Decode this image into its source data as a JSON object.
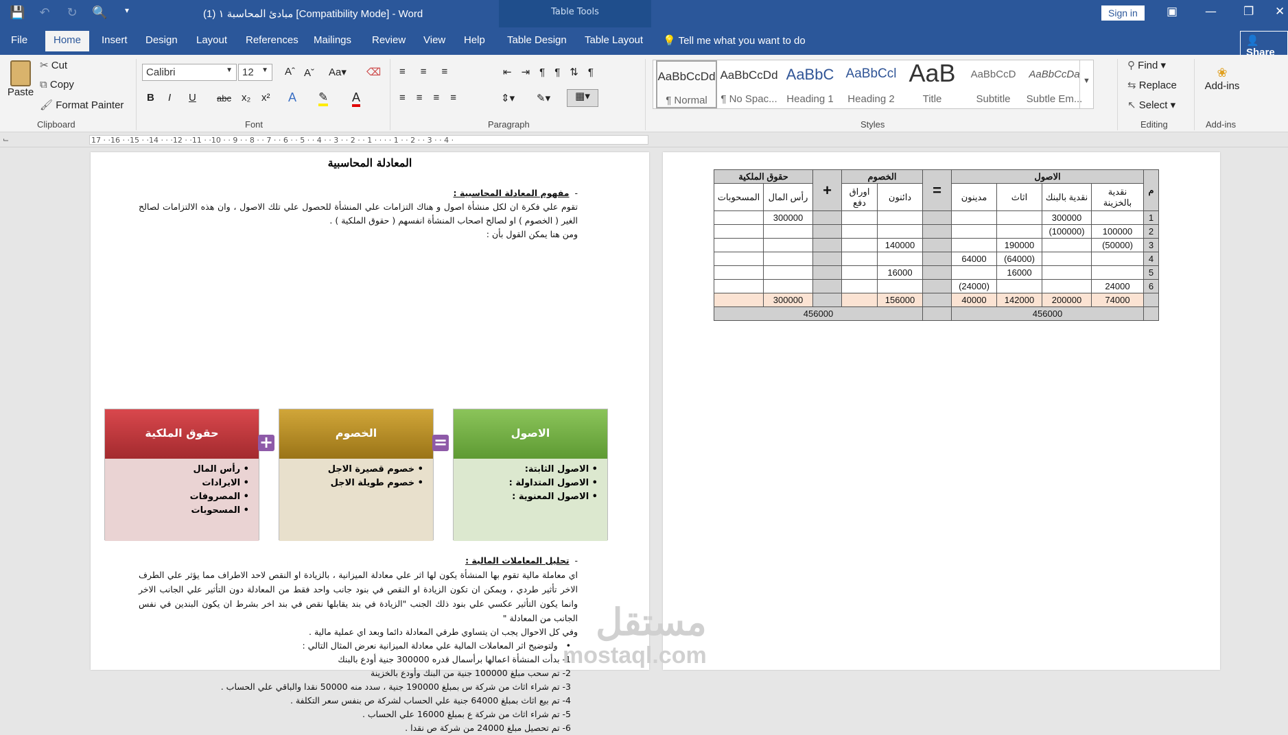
{
  "window": {
    "title": "مبادئ المحاسبة ١ (1) [Compatibility Mode]  -  Word",
    "context_tab_group": "Table Tools",
    "sign_in": "Sign in",
    "share": "Share"
  },
  "tabs": [
    "File",
    "Home",
    "Insert",
    "Design",
    "Layout",
    "References",
    "Mailings",
    "Review",
    "View",
    "Help",
    "Table Design",
    "Table Layout"
  ],
  "tell_me": "Tell me what you want to do",
  "ribbon": {
    "clipboard": {
      "paste": "Paste",
      "cut": "Cut",
      "copy": "Copy",
      "format_painter": "Format Painter",
      "label": "Clipboard"
    },
    "font": {
      "name": "Calibri",
      "size": "12",
      "label": "Font",
      "case": "Aa",
      "bold": "B",
      "italic": "I",
      "underline": "U",
      "strike": "abc",
      "sub": "x₂",
      "sup": "x²"
    },
    "paragraph": {
      "label": "Paragraph"
    },
    "styles": {
      "label": "Styles",
      "items": [
        {
          "preview": "AaBbCcDd",
          "name": "¶ Normal"
        },
        {
          "preview": "AaBbCcDd",
          "name": "¶ No Spac..."
        },
        {
          "preview": "AaBbC",
          "name": "Heading 1"
        },
        {
          "preview": "AaBbCcl",
          "name": "Heading 2"
        },
        {
          "preview": "AaB",
          "name": "Title"
        },
        {
          "preview": "AaBbCcD",
          "name": "Subtitle"
        },
        {
          "preview": "AaBbCcDa",
          "name": "Subtle Em..."
        }
      ]
    },
    "editing": {
      "find": "Find",
      "replace": "Replace",
      "select": "Select",
      "label": "Editing"
    },
    "addins": {
      "button": "Add-ins",
      "label": "Add-ins"
    }
  },
  "ruler": "17 · ·16 · ·15 · ·14 · · ·12 · ·11 · ·10 · · 9 · · 8 · · 7 · · 6 · · 5 · · 4 · · 3 · · 2 · · 1 · · · · 1 · · 2 · · 3 · · 4 ·",
  "page1": {
    "heading": "المعادلة المحاسبية",
    "concept_title": "مفهوم المعادلة المحاسبية :",
    "concept_text": "تقوم علي فكرة ان لكل منشأة اصول و هناك التزامات علي المنشأة للحصول علي تلك الاصول ، وان هذه الالتزامات لصالح الغير ( الخصوم ) او لصالح اصحاب المنشأة انفسهم ( حقوق الملكية ) .",
    "concept_end": "ومن هنا يمكن القول بأن :",
    "boxes": [
      {
        "title": "الاصول",
        "items": [
          "الاصول الثابتة:",
          "الاصول المتداولة :",
          "الاصول المعنوية :"
        ],
        "head_color": "#6aa84f",
        "body_color": "#dce8cf"
      },
      {
        "title": "الخصوم",
        "items": [
          "خصوم قصيرة الاجل",
          "خصوم طويلة الاجل"
        ],
        "head_color": "#b58a1f",
        "body_color": "#e8e0cc"
      },
      {
        "title": "حقوق الملكية",
        "items": [
          "رأس المال",
          "الايرادات",
          "المصروفات",
          "المسحوبات"
        ],
        "head_color": "#c0353a",
        "body_color": "#ead3d3"
      }
    ],
    "op_plus": "+",
    "op_eq": "=",
    "analysis_title": "تحليل المعاملات المالية :",
    "analysis_text": "اي معاملة مالية تقوم بها المنشأة يكون لها اثر علي معادلة الميزانية ، بالزيادة او النقص لاحد الاطراف مما يؤثر علي الطرف الاخر تأثير طردي ، ويمكن ان تكون الزيادة او النقص في بنود جانب واحد فقط من المعادلة دون التأثير علي الجانب الاخر وانما يكون التأثير عكسي علي بنود ذلك الجنب \"الزيادة في بند يقابلها نقص في بند اخر بشرط ان يكون البندين في نفس الجانب من المعادلة \"",
    "analysis_line": "وفي كل الاحوال يجب ان يتساوي طرفي المعادلة دائما وبعد اي عملية مالية .",
    "example_intro": "ولتوضيح اثر المعاملات المالية علي معادلة الميزانية نعرض المثال التالي :",
    "examples": [
      "1-   بدأت المنشأة اعمالها برأسمال قدره 300000 جنية أودع بالبنك",
      "2-   تم سحب مبلغ 100000 جنية من البنك وأودع بالخزينة",
      "3-   تم شراء اثاث من شركة س بمبلغ 190000 جنية ، سدد منه 50000 نقدا والباقي علي الحساب .",
      "4-   تم بيع اثاث بمبلغ 64000 جنية علي الحساب لشركة ص  بنفس سعر التكلفة .",
      "5-   تم شراء اثاث من شركة ع  بمبلغ 16000 علي الحساب .",
      "6-   تم تحصيل مبلغ 24000 من شركة ص نقدا ."
    ]
  },
  "table": {
    "h_num": "م",
    "h_assets": "الاصول",
    "h_liab": "الخصوم",
    "h_equity": "حقوق الملكية",
    "eq": "=",
    "plus": "+",
    "cols_assets": [
      "نقدية بالخزينة",
      "نقدية بالبنك",
      "اثاث",
      "مدينون"
    ],
    "cols_liab": [
      "دائنون",
      "اوراق دفع"
    ],
    "cols_equity": [
      "رأس المال",
      "المسحوبات"
    ],
    "rows": [
      {
        "n": "1",
        "a": [
          "",
          "300000",
          "",
          ""
        ],
        "l": [
          "",
          ""
        ],
        "e": [
          "300000",
          ""
        ]
      },
      {
        "n": "2",
        "a": [
          "100000",
          "(100000)",
          "",
          ""
        ],
        "l": [
          "",
          ""
        ],
        "e": [
          "",
          ""
        ]
      },
      {
        "n": "3",
        "a": [
          "(50000)",
          "",
          "190000",
          ""
        ],
        "l": [
          "140000",
          ""
        ],
        "e": [
          "",
          ""
        ]
      },
      {
        "n": "4",
        "a": [
          "",
          "",
          "(64000)",
          "64000"
        ],
        "l": [
          "",
          ""
        ],
        "e": [
          "",
          ""
        ]
      },
      {
        "n": "5",
        "a": [
          "",
          "",
          "16000",
          ""
        ],
        "l": [
          "16000",
          ""
        ],
        "e": [
          "",
          ""
        ]
      },
      {
        "n": "6",
        "a": [
          "24000",
          "",
          "",
          "(24000)"
        ],
        "l": [
          "",
          ""
        ],
        "e": [
          "",
          ""
        ]
      }
    ],
    "total": {
      "a": [
        "74000",
        "200000",
        "142000",
        "40000"
      ],
      "l": [
        "156000",
        ""
      ],
      "e": [
        "300000",
        ""
      ]
    },
    "grand_assets": "456000",
    "grand_right": "456000"
  },
  "watermark": {
    "arabic": "مستقل",
    "latin": "mostaql.com"
  }
}
